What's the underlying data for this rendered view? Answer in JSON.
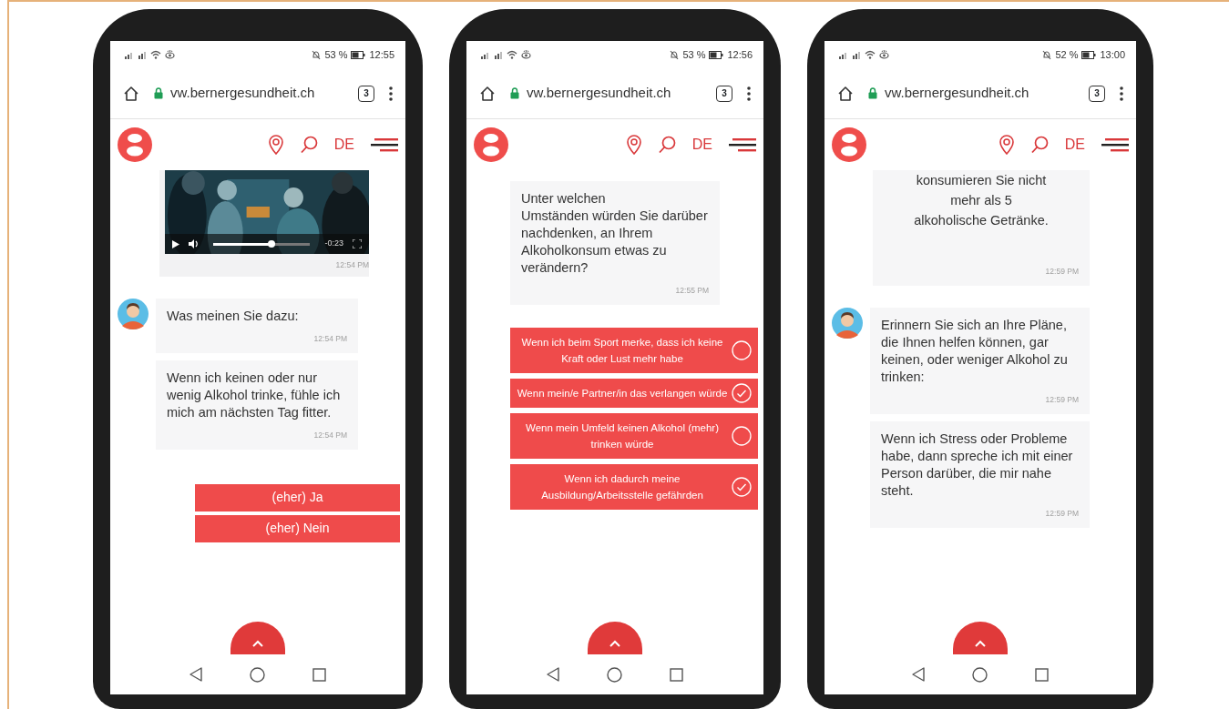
{
  "phones": [
    {
      "status_bar": {
        "battery": "53 %",
        "time": "12:55"
      },
      "browser": {
        "url": "vw.bernergesundheit.ch",
        "tab_count": "3"
      },
      "site_header": {
        "language": "DE"
      },
      "items": [
        {
          "kind": "video",
          "video_time": "-0:23",
          "level": 0.6,
          "timestamp": "12:54 PM"
        },
        {
          "kind": "avatar_group",
          "messages": [
            {
              "text": "Was meinen Sie dazu:",
              "timestamp": "12:54 PM"
            },
            {
              "text": "Wenn ich keinen oder nur wenig Alkohol trinke, fühle ich mich am nächsten Tag fitter.",
              "timestamp": "12:54 PM"
            }
          ]
        },
        {
          "kind": "buttons",
          "items": [
            {
              "label": "(eher) Ja"
            },
            {
              "label": "(eher) Nein"
            }
          ]
        }
      ]
    },
    {
      "status_bar": {
        "battery": "53 %",
        "time": "12:56"
      },
      "browser": {
        "url": "vw.bernergesundheit.ch",
        "tab_count": "3"
      },
      "site_header": {
        "language": "DE"
      },
      "items": [
        {
          "kind": "bubble",
          "text": "Unter welchen\nUmständen würden Sie darüber nachdenken, an Ihrem Alkoholkonsum etwas zu verändern?",
          "timestamp": "12:55 PM"
        },
        {
          "kind": "options",
          "items": [
            {
              "label": "Wenn ich beim Sport merke, dass ich keine Kraft oder Lust mehr habe",
              "checked": false
            },
            {
              "label": "Wenn mein/e Partner/in das verlangen würde",
              "checked": true
            },
            {
              "label": "Wenn mein Umfeld keinen Alkohol (mehr) trinken würde",
              "checked": false
            },
            {
              "label": "Wenn ich dadurch meine Ausbildung/Arbeitsstelle gefährden",
              "checked": true
            }
          ]
        }
      ]
    },
    {
      "status_bar": {
        "battery": "52 %",
        "time": "13:00"
      },
      "browser": {
        "url": "vw.bernergesundheit.ch",
        "tab_count": "3"
      },
      "site_header": {
        "language": "DE"
      },
      "items": [
        {
          "kind": "note",
          "text": "konsumieren Sie nicht\nmehr als 5\nalkoholische Getränke.",
          "timestamp": "12:59 PM"
        },
        {
          "kind": "avatar_group",
          "messages": [
            {
              "text": "Erinnern Sie sich an Ihre Pläne, die Ihnen helfen können, gar keinen, oder weniger Alkohol zu trinken:",
              "timestamp": "12:59 PM"
            },
            {
              "text": "Wenn ich Stress oder Probleme habe, dann spreche ich mit einer Person darüber, die mir nahe steht.",
              "timestamp": "12:59 PM"
            }
          ]
        }
      ]
    }
  ]
}
